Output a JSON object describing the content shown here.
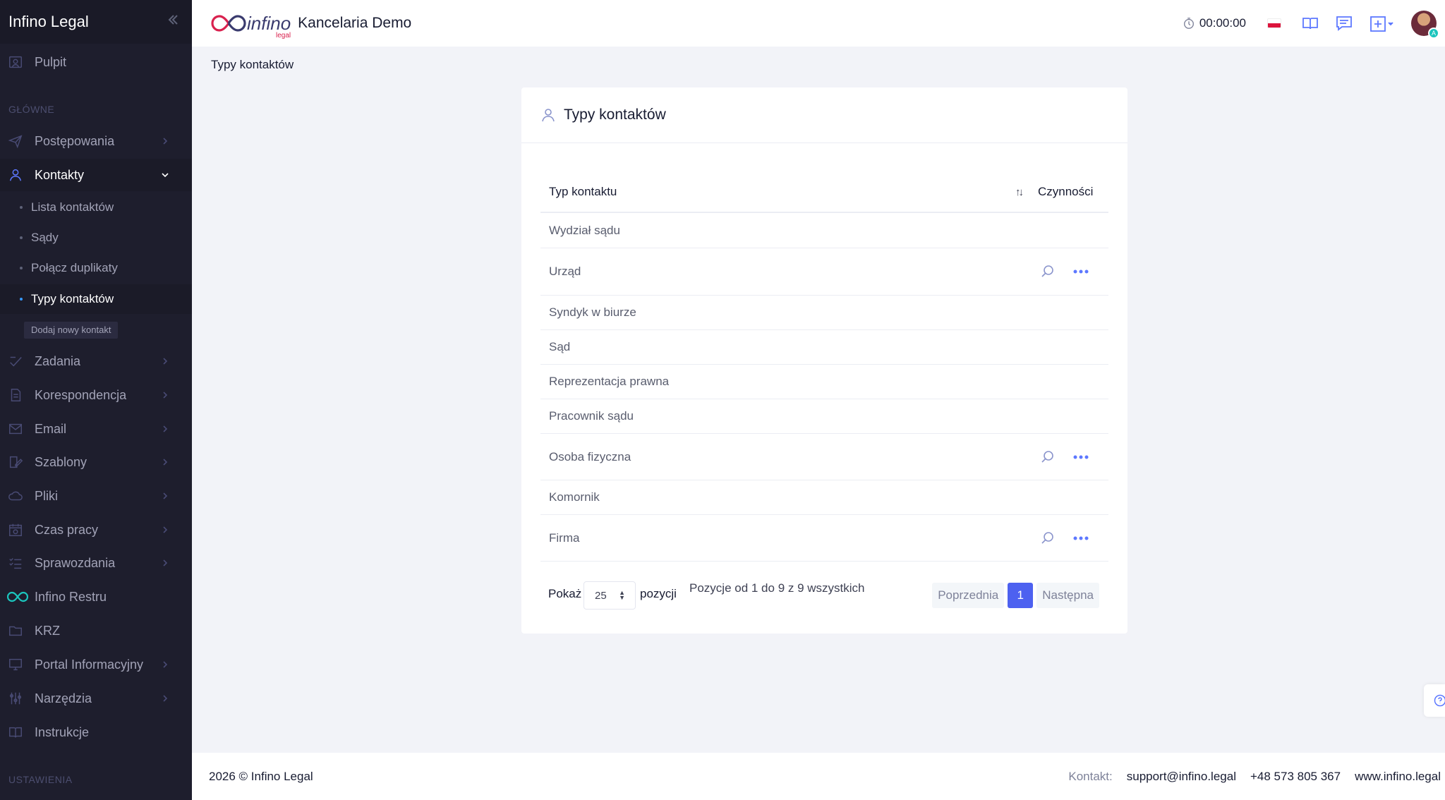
{
  "sidebar": {
    "brand": "Infino Legal",
    "dashboard": "Pulpit",
    "section_main": "GŁÓWNE",
    "section_settings": "USTAWIENIA",
    "items": {
      "postepowania": "Postępowania",
      "kontakty": "Kontakty",
      "zadania": "Zadania",
      "korespondencja": "Korespondencja",
      "email": "Email",
      "szablony": "Szablony",
      "pliki": "Pliki",
      "czas_pracy": "Czas pracy",
      "sprawozdania": "Sprawozdania",
      "infino_restru": "Infino Restru",
      "krz": "KRZ",
      "portal": "Portal Informacyjny",
      "narzedzia": "Narzędzia",
      "instrukcje": "Instrukcje"
    },
    "kontakty_sub": {
      "lista": "Lista kontaktów",
      "sady": "Sądy",
      "polacz": "Połącz duplikaty",
      "typy": "Typy kontaktów"
    },
    "add_contact": "Dodaj nowy kontakt"
  },
  "header": {
    "logo_word": "infino",
    "logo_sub": "legal",
    "firm_name": "Kancelaria Demo",
    "timer": "00:00:00",
    "flag": "pl-flag-icon"
  },
  "breadcrumb": "Typy kontaktów",
  "card": {
    "title": "Typy kontaktów",
    "col_type": "Typ kontaktu",
    "col_actions": "Czynności",
    "rows": [
      "Wydział sądu",
      "Urząd",
      "Syndyk w biurze",
      "Sąd",
      "Reprezentacja prawna",
      "Pracownik sądu",
      "Osoba fizyczna",
      "Komornik",
      "Firma"
    ],
    "show_label": "Pokaż",
    "page_size": "25",
    "positions_label": "pozycji",
    "info": "Pozycje od 1 do 9 z 9 wszystkich",
    "prev": "Poprzednia",
    "current_page": "1",
    "next": "Następna"
  },
  "footer": {
    "copyright": "2026 © Infino Legal",
    "contact_label": "Kontakt:",
    "email": "support@infino.legal",
    "phone": "+48 573 805 367",
    "website": "www.infino.legal"
  },
  "colors": {
    "sidebar_bg": "#1e1e2d",
    "accent": "#4d61f0",
    "page_bg": "#f2f3f8"
  }
}
